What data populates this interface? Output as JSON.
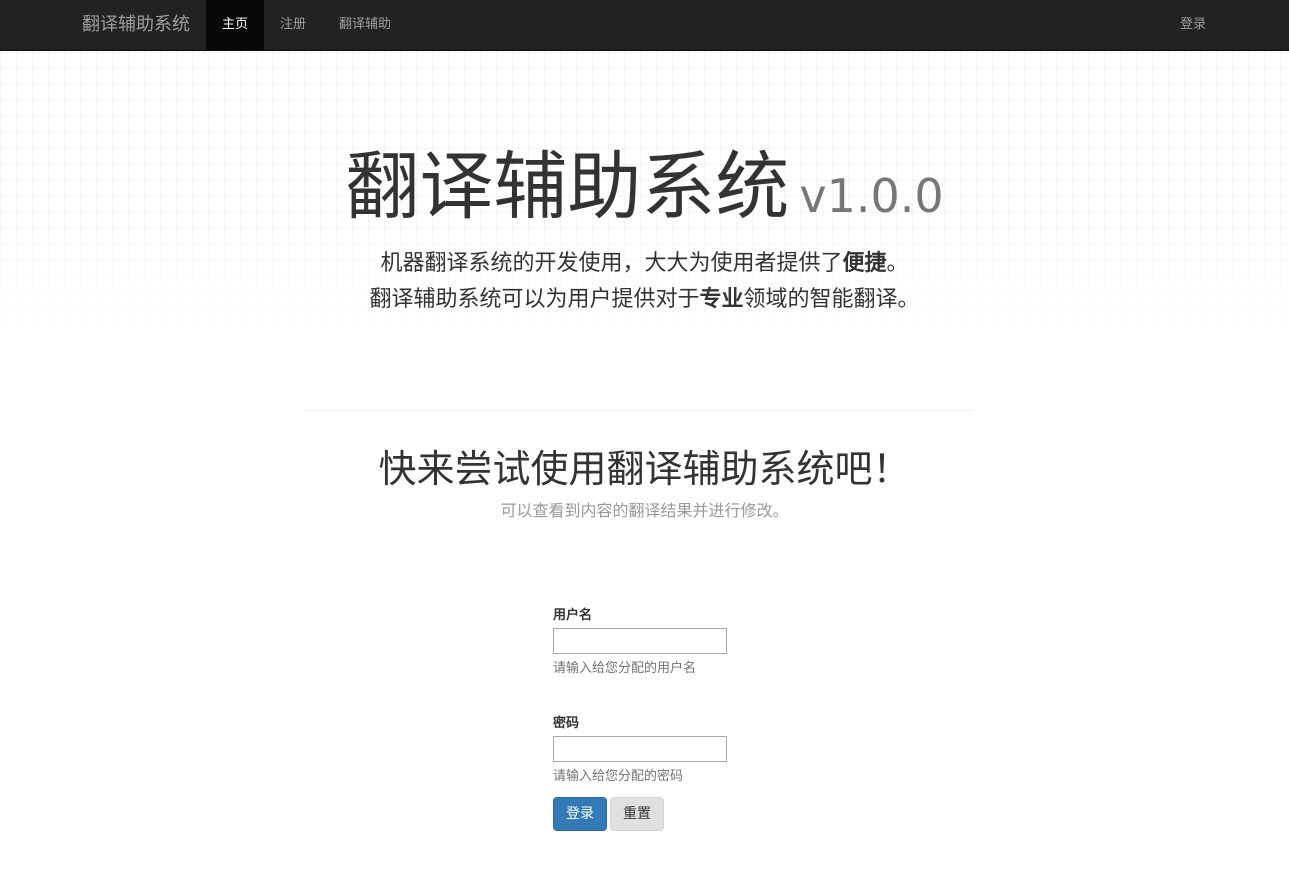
{
  "navbar": {
    "brand": "翻译辅助系统",
    "items": [
      {
        "label": "主页",
        "active": true
      },
      {
        "label": "注册",
        "active": false
      },
      {
        "label": "翻译辅助",
        "active": false
      }
    ],
    "right_item": "登录"
  },
  "hero": {
    "title": "翻译辅助系统",
    "version": "v1.0.0",
    "line1_before": "机器翻译系统的开发使用，大大为使用者提供了",
    "line1_bold": "便捷",
    "line1_after": "。",
    "line2_before": "翻译辅助系统可以为用户提供对于",
    "line2_bold": "专业",
    "line2_after": "领域的智能翻译。"
  },
  "section": {
    "title": "快来尝试使用翻译辅助系统吧！",
    "subtitle": "可以查看到内容的翻译结果并进行修改。"
  },
  "form": {
    "username_label": "用户名",
    "username_value": "",
    "username_help": "请输入给您分配的用户名",
    "password_label": "密码",
    "password_value": "",
    "password_help": "请输入给您分配的密码",
    "login_button": "登录",
    "reset_button": "重置"
  },
  "colors": {
    "navbar_bg": "#222222",
    "nav_active_bg": "#080808",
    "primary": "#337ab7"
  }
}
